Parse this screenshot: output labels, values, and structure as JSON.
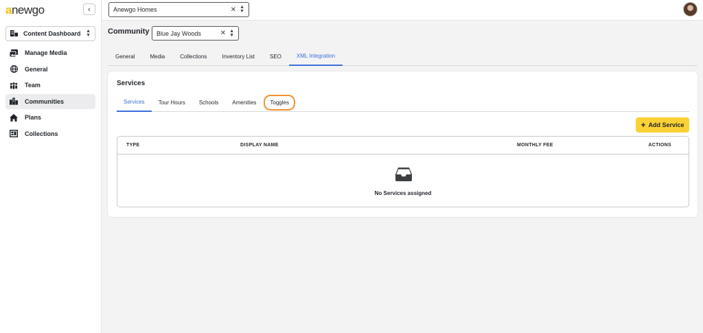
{
  "app": {
    "logo_a": "a",
    "logo_rest": "newgo"
  },
  "sidebar": {
    "dashboard_select": "Content Dashboard",
    "items": [
      {
        "label": "Manage Media",
        "icon": "media-icon"
      },
      {
        "label": "General",
        "icon": "globe-icon"
      },
      {
        "label": "Team",
        "icon": "team-icon"
      },
      {
        "label": "Communities",
        "icon": "communities-icon",
        "active": true
      },
      {
        "label": "Plans",
        "icon": "home-icon"
      },
      {
        "label": "Collections",
        "icon": "collections-icon"
      }
    ]
  },
  "topbar": {
    "org_value": "Anewgo Homes"
  },
  "community": {
    "label": "Community",
    "value": "Blue Jay Woods"
  },
  "main_tabs": [
    "General",
    "Media",
    "Collections",
    "Inventory List",
    "SEO",
    "XML Integration"
  ],
  "card": {
    "title": "Services",
    "sub_tabs": [
      "Services",
      "Tour Hours",
      "Schools",
      "Amenities",
      "Toggles"
    ],
    "add_button": "Add Service",
    "table": {
      "columns": [
        "TYPE",
        "DISPLAY NAME",
        "MONTHLY FEE",
        "ACTIONS"
      ],
      "empty_text": "No Services assigned"
    }
  },
  "colors": {
    "accent": "#3b6fd8",
    "button_yellow": "#fbd135",
    "highlight_orange": "#f2922e",
    "logo_yellow": "#f2c200"
  }
}
